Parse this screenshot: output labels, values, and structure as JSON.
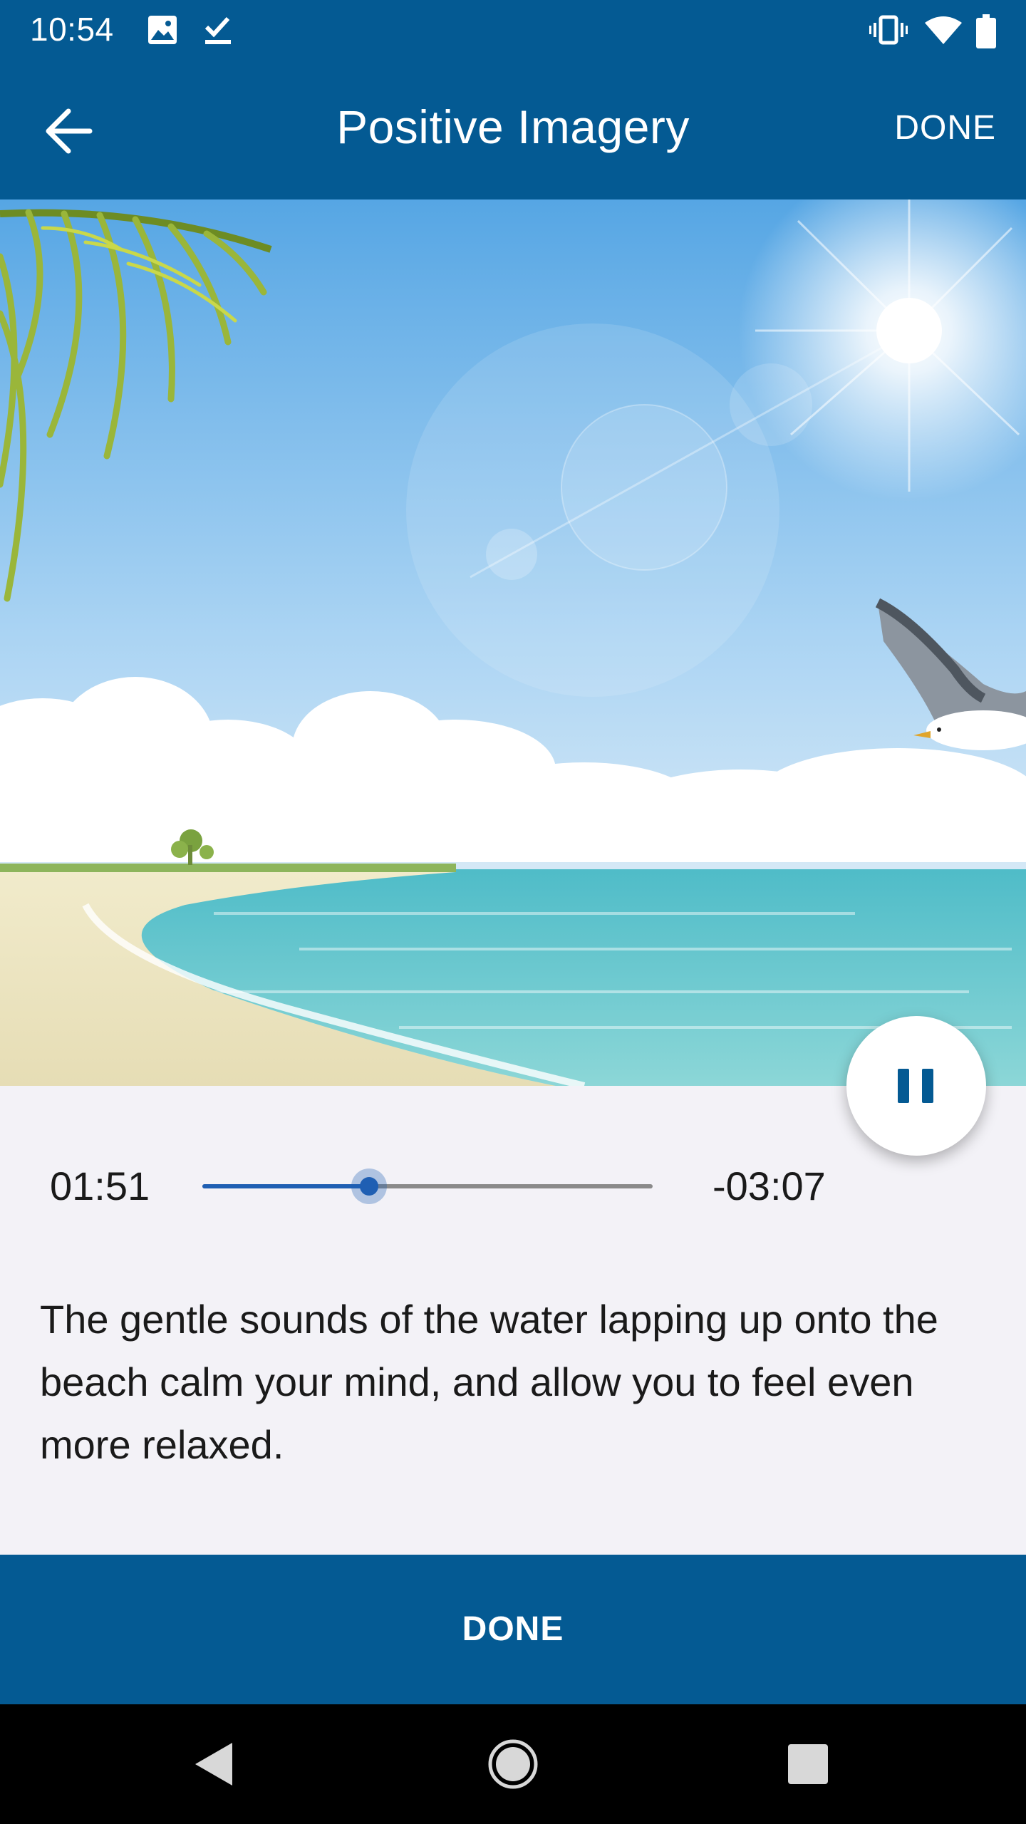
{
  "status_bar": {
    "time": "10:54",
    "left_icons": [
      "image-icon",
      "checkmark-download-icon"
    ],
    "right_icons": [
      "vibrate-icon",
      "wifi-icon",
      "battery-icon"
    ]
  },
  "app_bar": {
    "title": "Positive Imagery",
    "done_label": "DONE",
    "back_icon": "arrow-left-icon"
  },
  "hero": {
    "scene": "beach-illustration",
    "icons": [
      "palm-leaf",
      "sun",
      "seagull",
      "clouds",
      "island",
      "sea"
    ]
  },
  "player": {
    "state_icon": "pause-icon",
    "elapsed": "01:51",
    "remaining": "-03:07",
    "progress_fraction": 0.37
  },
  "description": "The gentle sounds of the water lapping up onto the beach calm your mind, and allow you to feel even more relaxed.",
  "footer": {
    "done_label": "DONE"
  },
  "nav_bar": {
    "icons": [
      "back-triangle-icon",
      "home-circle-icon",
      "recents-square-icon"
    ]
  },
  "colors": {
    "primary": "#045a93",
    "accent": "#1f5fb3",
    "background": "#f3f2f7"
  }
}
